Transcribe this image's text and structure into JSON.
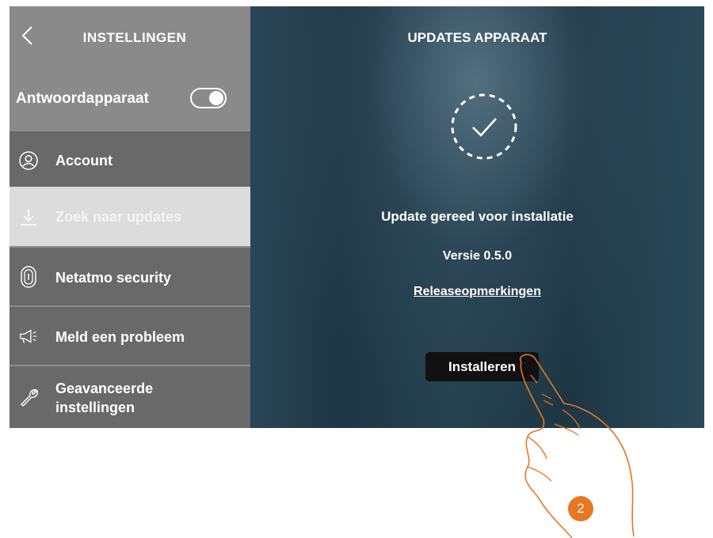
{
  "sidebar": {
    "title": "INSTELLINGEN",
    "toggle_label": "Antwoordapparaat",
    "toggle_on": true,
    "items": [
      {
        "label": "Account",
        "icon": "user-icon"
      },
      {
        "label": "Zoek naar updates",
        "icon": "download-icon",
        "active": true
      },
      {
        "label": "Netatmo security",
        "icon": "fingerprint-icon"
      },
      {
        "label": "Meld een probleem",
        "icon": "megaphone-icon"
      },
      {
        "label": "Geavanceerde\ninstellingen",
        "icon": "wrench-icon"
      }
    ]
  },
  "main": {
    "title": "UPDATES APPARAAT",
    "status": "Update gereed voor installatie",
    "version": "Versie 0.5.0",
    "release_notes_link": "Releaseopmerkingen",
    "install_button": "Installeren"
  },
  "annotation": {
    "step_number": "2",
    "accent_color": "#e87722"
  }
}
